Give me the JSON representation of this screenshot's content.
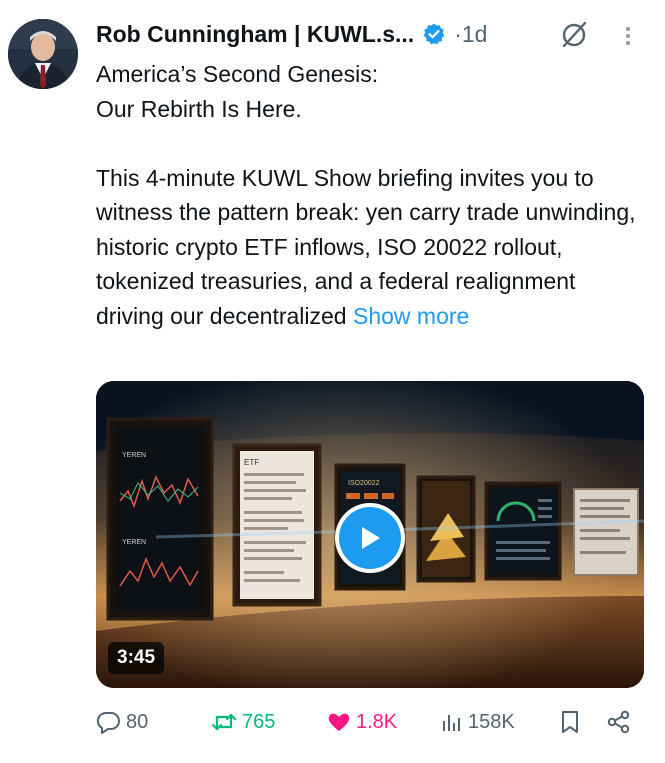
{
  "tweet": {
    "author_name": "Rob Cunningham | KUWL.s...",
    "separator": "·",
    "time": "1d",
    "text_lines_1": [
      "America’s Second Genesis:",
      "Our Rebirth Is Here."
    ],
    "text_body": "This 4-minute KUWL Show briefing invites you to witness the pattern break: yen carry trade unwinding, historic crypto ETF inflows, ISO 20022 rollout, tokenized treasuries, and a federal realignment driving our decentralized",
    "show_more": "Show more"
  },
  "media": {
    "duration": "3:45",
    "panel_text_1": "YEREN",
    "panel_text_2": "YEREN",
    "panel_text_3": "ETF",
    "panel_text_4": "ISO20022"
  },
  "actions": {
    "replies": "80",
    "retweets": "765",
    "likes": "1.8K",
    "views": "158K"
  },
  "colors": {
    "accent": "#1d9bf0",
    "retweet": "#00ba7c",
    "like": "#f91880",
    "muted": "#536471"
  },
  "icons": [
    "verified-badge-icon",
    "grok-icon",
    "more-options-icon",
    "play-icon",
    "reply-icon",
    "retweet-icon",
    "like-icon",
    "views-icon",
    "bookmark-icon",
    "share-icon"
  ]
}
